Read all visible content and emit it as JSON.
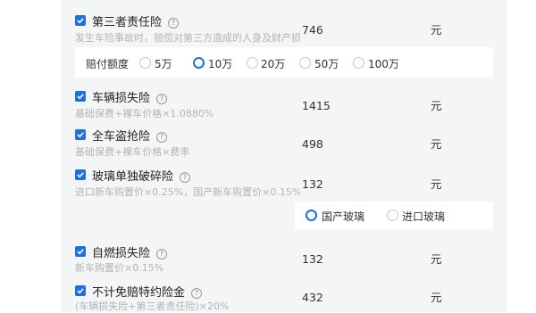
{
  "items": [
    {
      "title": "第三者责任险",
      "desc": "发生车险事故时，赔偿对第三方造成的人身及财产损失",
      "price": "746",
      "unit": "元"
    },
    {
      "title": "车辆损失险",
      "desc": "基础保费+裸车价格×1.0880%",
      "price": "1415",
      "unit": "元"
    },
    {
      "title": "全车盗抢险",
      "desc": "基础保费+裸车价格×费率",
      "price": "498",
      "unit": "元"
    },
    {
      "title": "玻璃单独破碎险",
      "desc": "进口新车购置价×0.25%，国产新车购置价×0.15%",
      "price": "132",
      "unit": "元"
    },
    {
      "title": "自燃损失险",
      "desc": "新车购置价×0.15%",
      "price": "132",
      "unit": "元"
    },
    {
      "title": "不计免赔特约险金",
      "desc": "(车辆损失险+第三者责任险)×20%",
      "price": "432",
      "unit": "元"
    }
  ],
  "liability_options": {
    "label": "赔付额度",
    "options": [
      "5万",
      "10万",
      "20万",
      "50万",
      "100万"
    ],
    "selected": "10万"
  },
  "glass_options": {
    "options": [
      "国产玻璃",
      "进口玻璃"
    ],
    "selected": "国产玻璃"
  },
  "help_glyph": "?",
  "colors": {
    "accent": "#1f6fe0",
    "desc": "#b4b4b4",
    "panel": "#f4f5f7"
  }
}
